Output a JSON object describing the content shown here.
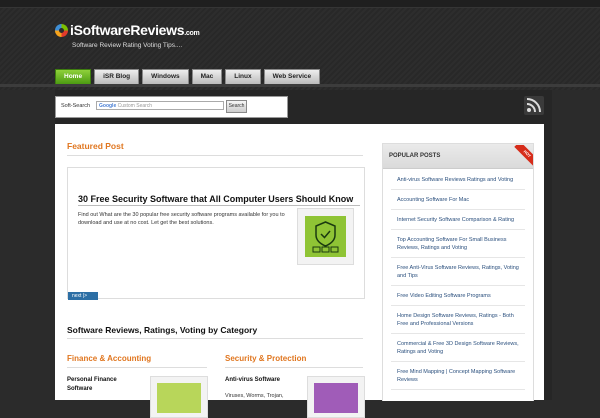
{
  "brand": {
    "name": "iSoftwareReviews",
    "domain": ".com",
    "tagline": "Software Review Rating Voting Tips...."
  },
  "nav": {
    "tabs": [
      "Home",
      "iSR Blog",
      "Windows",
      "Mac",
      "Linux",
      "Web Service"
    ]
  },
  "search": {
    "label": "Soft-Search",
    "placeholder_brand": "Google",
    "placeholder": "Custom Search",
    "button": "Search"
  },
  "featured": {
    "title": "Featured Post",
    "headline": "30 Free Security Software that All Computer Users Should Know",
    "description": "Find out What are the 30 popular free security software programs available for you to download and use at no cost. Let get the best solutions.",
    "next_label": "next"
  },
  "categories": {
    "heading": "Software Reviews, Ratings, Voting by Category",
    "columns": [
      {
        "title": "Finance & Accounting",
        "item_title": "Personal Finance Software",
        "thumb_color": "#b8d65a"
      },
      {
        "title": "Security & Protection",
        "item_title": "Anti-virus Software",
        "item_text": "Viruses, Worms, Trojan,",
        "thumb_color": "#a05cb8"
      }
    ]
  },
  "sidebar": {
    "title": "POPULAR POSTS",
    "badge": "HOT",
    "posts": [
      "Anti-virus Software Reviews Ratings and Voting",
      "Accounting Software For Mac",
      "Internet Security Software Comparison & Rating",
      "Top Accounting Software For Small Business Reviews, Ratings and Voting",
      "Free Anti-Virus Software Reviews, Ratings, Voting and Tips",
      "Free Video Editing Software Programs",
      "Home Design Software Reviews, Ratings - Both Free and Professional Versions",
      "Commercial & Free 3D Design Software Reviews, Ratings and Voting",
      "Free Mind Mapping | Concept Mapping Software Reviews"
    ]
  },
  "colors": {
    "accent_orange": "#e0761f",
    "nav_active": "#5aa51a",
    "link_blue": "#2a4f7d"
  }
}
